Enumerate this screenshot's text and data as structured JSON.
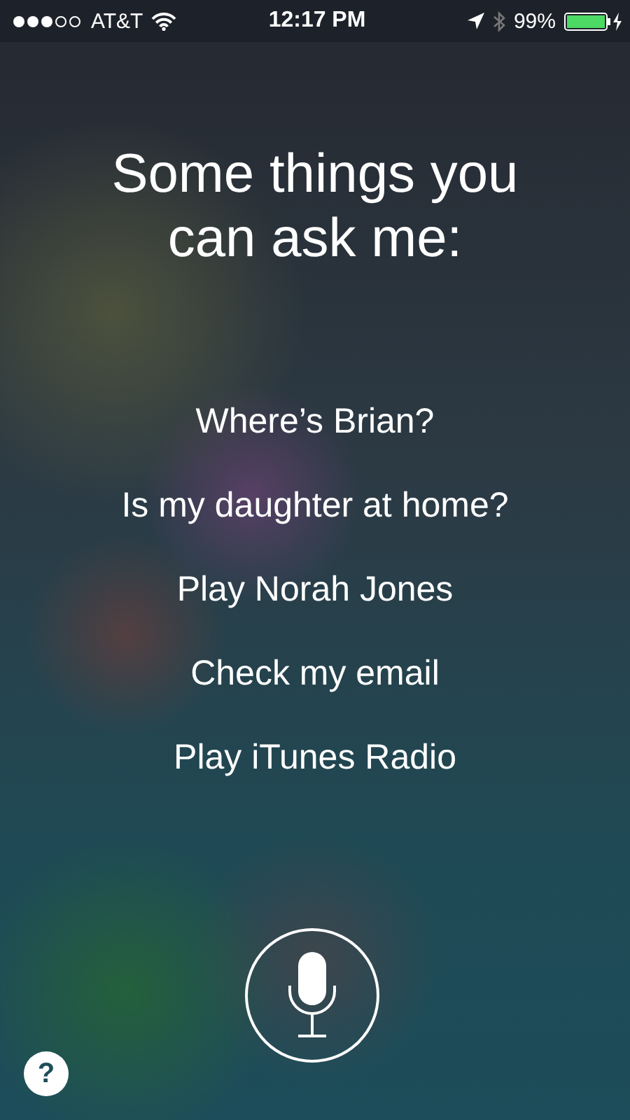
{
  "status_bar": {
    "carrier": "AT&T",
    "time": "12:17 PM",
    "battery": "99%"
  },
  "title": "Some things you can ask me:",
  "suggestions": [
    "Where’s Brian?",
    "Is my daughter at home?",
    "Play Norah Jones",
    "Check my email",
    "Play iTunes Radio"
  ],
  "help_button": "?"
}
